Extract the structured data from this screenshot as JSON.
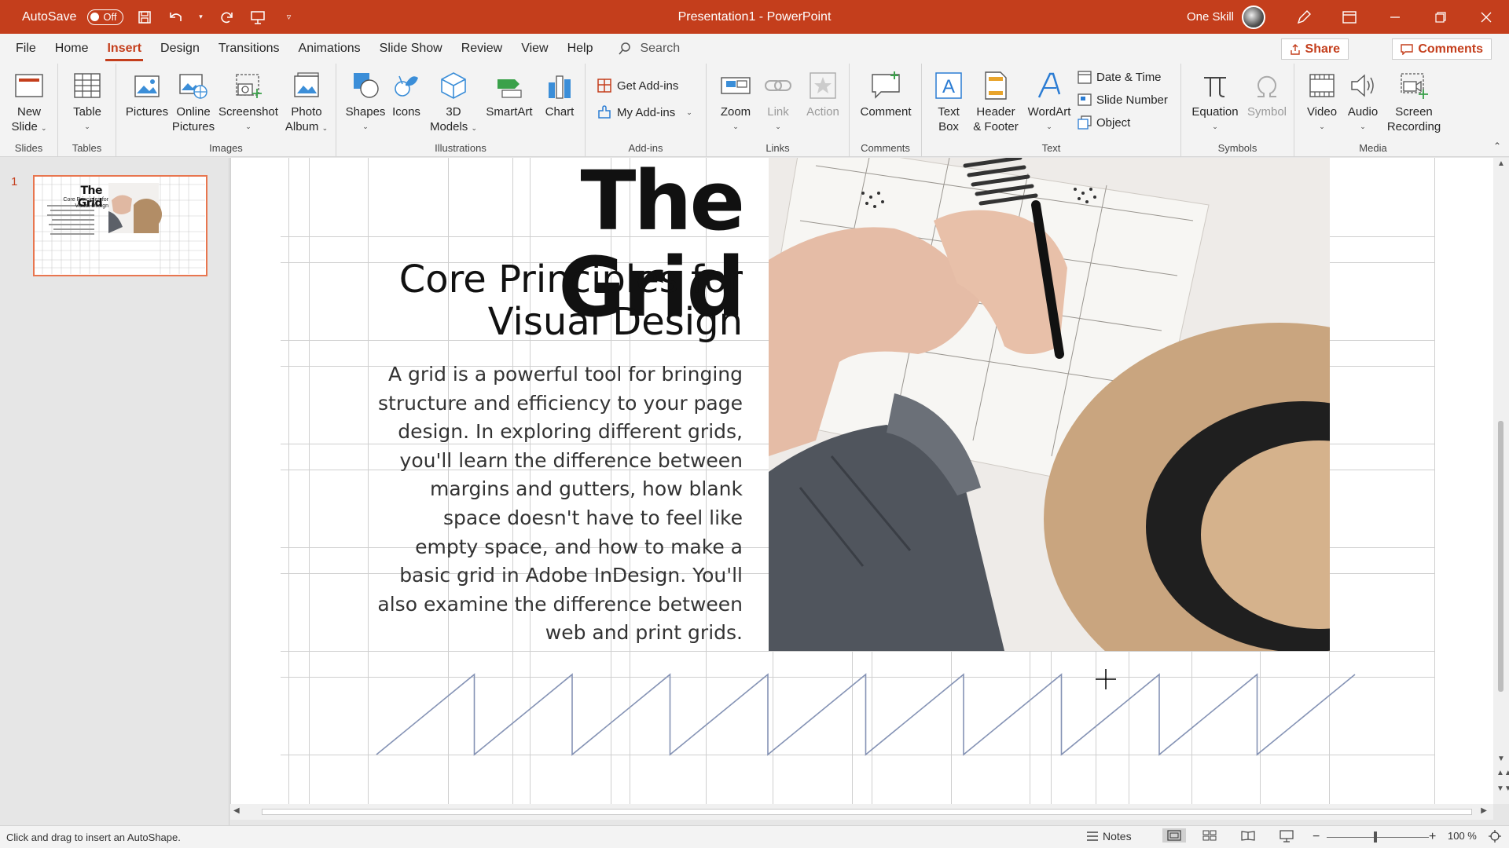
{
  "titlebar": {
    "autosave_label": "AutoSave",
    "autosave_state": "Off",
    "title": "Presentation1  -  PowerPoint",
    "user": "One Skill"
  },
  "menu": {
    "tabs": [
      "File",
      "Home",
      "Insert",
      "Design",
      "Transitions",
      "Animations",
      "Slide Show",
      "Review",
      "View",
      "Help"
    ],
    "active": "Insert",
    "search": "Search",
    "share": "Share",
    "comments": "Comments"
  },
  "ribbon": {
    "groups": {
      "slides": "Slides",
      "tables": "Tables",
      "images": "Images",
      "illustrations": "Illustrations",
      "addins": "Add-ins",
      "links": "Links",
      "comments": "Comments",
      "text": "Text",
      "symbols": "Symbols",
      "media": "Media"
    },
    "buttons": {
      "new_slide_1": "New",
      "new_slide_2": "Slide",
      "table": "Table",
      "pictures": "Pictures",
      "online_1": "Online",
      "online_2": "Pictures",
      "screenshot": "Screenshot",
      "photo_1": "Photo",
      "photo_2": "Album",
      "shapes": "Shapes",
      "icons": "Icons",
      "models_1": "3D",
      "models_2": "Models",
      "smartart": "SmartArt",
      "chart": "Chart",
      "get_addins": "Get Add-ins",
      "my_addins": "My Add-ins",
      "zoom": "Zoom",
      "link": "Link",
      "action": "Action",
      "comment": "Comment",
      "textbox_1": "Text",
      "textbox_2": "Box",
      "header_1": "Header",
      "header_2": "& Footer",
      "wordart": "WordArt",
      "date_time": "Date & Time",
      "slide_number": "Slide Number",
      "object": "Object",
      "equation": "Equation",
      "symbol": "Symbol",
      "video": "Video",
      "audio": "Audio",
      "screen_rec_1": "Screen",
      "screen_rec_2": "Recording"
    }
  },
  "thumbnail": {
    "number": "1",
    "title": "The Grid",
    "subtitle_1": "Core Principles for",
    "subtitle_2": "Visual Design"
  },
  "slide": {
    "title": "The Grid",
    "subtitle": "Core Principles for Visual Design",
    "body": "A grid is a powerful tool for bringing structure and efficiency to your page design. In exploring different grids, you'll learn the difference between margins and gutters, how blank space doesn't have to feel like empty space, and how to make a basic grid in Adobe InDesign. You'll also examine the difference between web and print grids."
  },
  "status": {
    "hint": "Click and drag to insert an AutoShape.",
    "notes": "Notes",
    "zoom": "100 %"
  },
  "colors": {
    "accent": "#c43e1c",
    "ribbon_bg": "#f3f3f3"
  }
}
